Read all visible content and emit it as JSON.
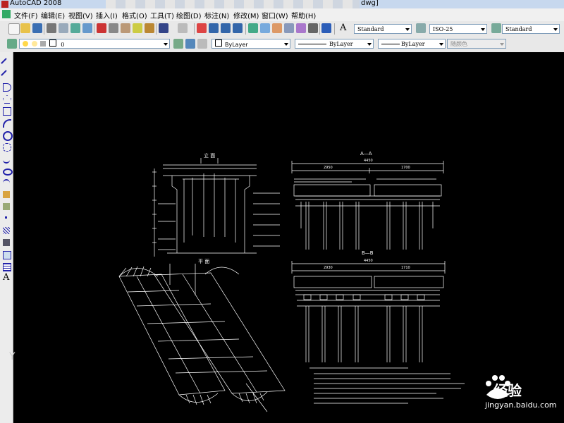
{
  "window": {
    "app_title": "AutoCAD 2008",
    "file_suffix": "dwg]"
  },
  "menu": {
    "items": [
      "文件(F)",
      "编辑(E)",
      "视图(V)",
      "插入(I)",
      "格式(O)",
      "工具(T)",
      "绘图(D)",
      "标注(N)",
      "修改(M)",
      "窗口(W)",
      "帮助(H)"
    ]
  },
  "styles_toolbar": {
    "text_style": "Standard",
    "dim_style": "ISO-25",
    "table_style": "Standard"
  },
  "layers_toolbar": {
    "layer": "0"
  },
  "properties_toolbar": {
    "color": "ByLayer",
    "linetype": "ByLayer",
    "lineweight": "ByLayer",
    "plot_style": "随颜色"
  },
  "drawing": {
    "elevation_title": "立 面",
    "plan_title": "平 面",
    "section_a": "A—A",
    "section_b": "B—B",
    "dim_a_total": "4450",
    "dim_a_left": "2950",
    "dim_a_right": "1700",
    "dim_b_total": "4450",
    "dim_b_left": "2930",
    "dim_b_right": "1710"
  },
  "ucs_icon_label": "Y",
  "watermark": {
    "brand": "经验",
    "url": "jingyan.baidu.com"
  },
  "colors": {
    "canvas": "#000000",
    "lines": "#ffffff",
    "toolbar": "#e8e8e8"
  }
}
